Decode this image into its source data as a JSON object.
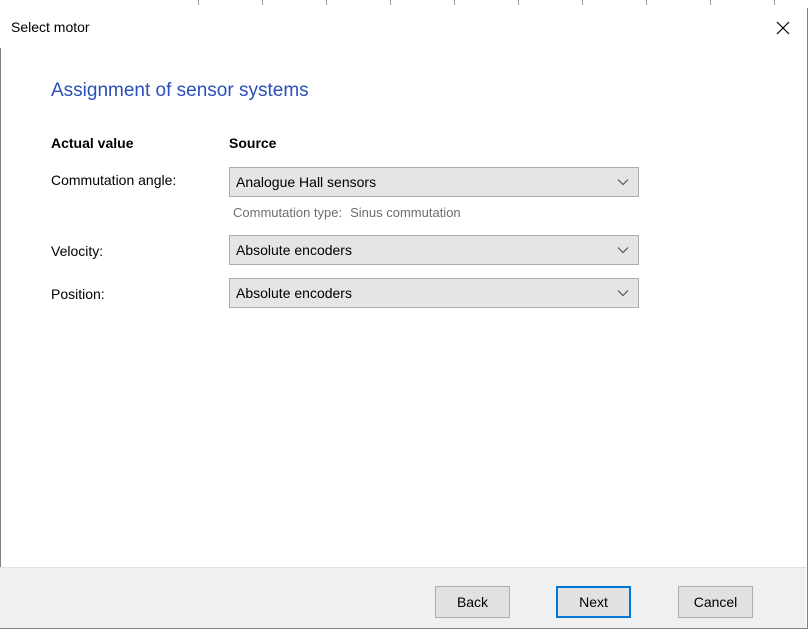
{
  "window": {
    "title": "Select motor"
  },
  "page": {
    "heading": "Assignment of sensor systems"
  },
  "columns": {
    "actual_value": "Actual value",
    "source": "Source"
  },
  "rows": [
    {
      "label": "Commutation angle:",
      "value": "Analogue Hall sensors"
    },
    {
      "label": "Velocity:",
      "value": "Absolute encoders"
    },
    {
      "label": "Position:",
      "value": "Absolute encoders"
    }
  ],
  "commutation_type": {
    "label": "Commutation type:",
    "value": "Sinus commutation"
  },
  "buttons": {
    "back": "Back",
    "next": "Next",
    "cancel": "Cancel"
  },
  "colors": {
    "heading": "#2b4fb8",
    "primary_border": "#0078d7",
    "footer_bg": "#f0f0f0",
    "combo_bg": "#e5e5e5"
  },
  "icons": {
    "close": "close-icon",
    "dropdown": "chevron-down-icon"
  }
}
